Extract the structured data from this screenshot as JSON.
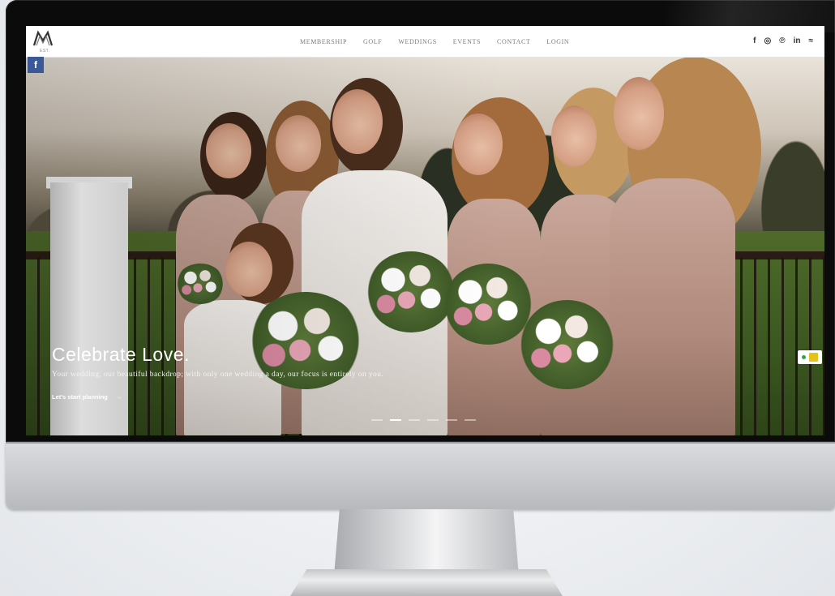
{
  "nav": {
    "logo_text": "M",
    "logo_sub": "EST.",
    "menu": [
      "MEMBERSHIP",
      "GOLF",
      "WEDDINGS",
      "EVENTS",
      "CONTACT",
      "LOGIN"
    ],
    "social_icons": [
      {
        "name": "facebook-icon",
        "glyph": "f"
      },
      {
        "name": "instagram-icon",
        "glyph": "◎"
      },
      {
        "name": "pinterest-icon",
        "glyph": "℗"
      },
      {
        "name": "linkedin-icon",
        "glyph": "in"
      },
      {
        "name": "rss-icon",
        "glyph": "≈"
      }
    ]
  },
  "side": {
    "facebook_badge": "f"
  },
  "hero": {
    "title": "Celebrate Love.",
    "subtitle": "Your wedding, our beautiful backdrop; with only one wedding a day, our focus is entirely on you.",
    "cta_label": "Let's start planning",
    "cta_arrow": "→",
    "slide_count": 6,
    "active_slide": 1
  },
  "colors": {
    "facebook_blue": "#3b5998",
    "nav_text": "#7b7b7b",
    "chat_green": "#2ba84a",
    "chat_yellow": "#e5c21a"
  }
}
